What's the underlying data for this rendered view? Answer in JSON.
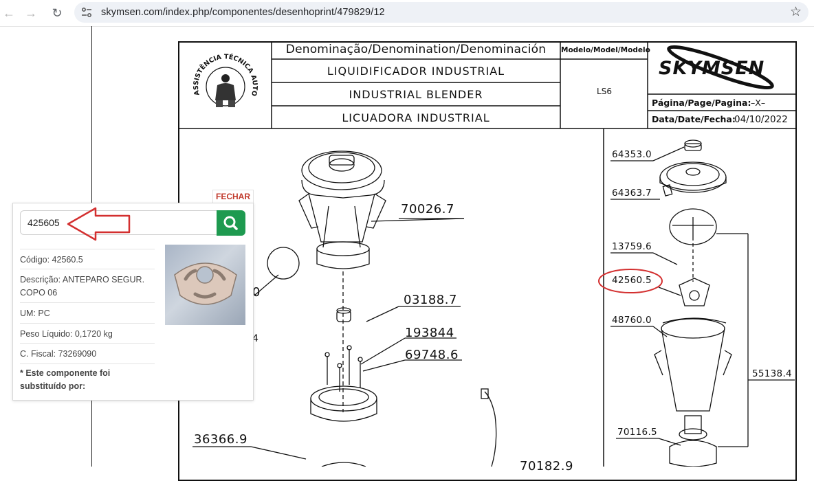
{
  "browser": {
    "url": "skymsen.com/index.php/componentes/desenhoprint/479829/12",
    "icons": [
      "back-arrow-icon",
      "forward-arrow-icon",
      "reload-icon",
      "site-settings-icon",
      "bookmark-star-icon"
    ]
  },
  "drawing": {
    "denomination_title": "Denominação/Denomination/Denominación",
    "names": [
      "LIQUIDIFICADOR  INDUSTRIAL",
      "INDUSTRIAL  BLENDER",
      "LICUADORA  INDUSTRIAL"
    ],
    "model_label": "Modelo/Model/Modelo",
    "model_value": "LS6",
    "brand": "SKYMSEN",
    "seal_text": "ASSISTÊNCIA TÉCNICA AUTORIZADA",
    "page_label": "Página/Page/Pagina:",
    "page_value": "–X–",
    "date_label": "Data/Date/Fecha:",
    "date_value": "04/10/2022",
    "parts_left": [
      "70026.7",
      "03188.7",
      "193844",
      "69748.6",
      "36366.9",
      "70182.9",
      "0",
      "4"
    ],
    "parts_right": [
      "64353.0",
      "64363.7",
      "13759.6",
      "42560.5",
      "48760.0",
      "55138.4",
      "70116.5"
    ],
    "highlighted_part": "42560.5"
  },
  "popup": {
    "close_label": "FECHAR",
    "search_value": "425605",
    "details": [
      "Código: 42560.5",
      "Descrição: ANTEPARO SEGUR. COPO 06",
      "UM: PC",
      "Peso Líquido: 0,1720 kg",
      "C. Fiscal: 73269090"
    ],
    "note": "* Este componente foi substituído por:"
  },
  "colors": {
    "accent_green": "#1e9a50",
    "annotation_red": "#d32f2f",
    "close_red": "#c0392b"
  }
}
